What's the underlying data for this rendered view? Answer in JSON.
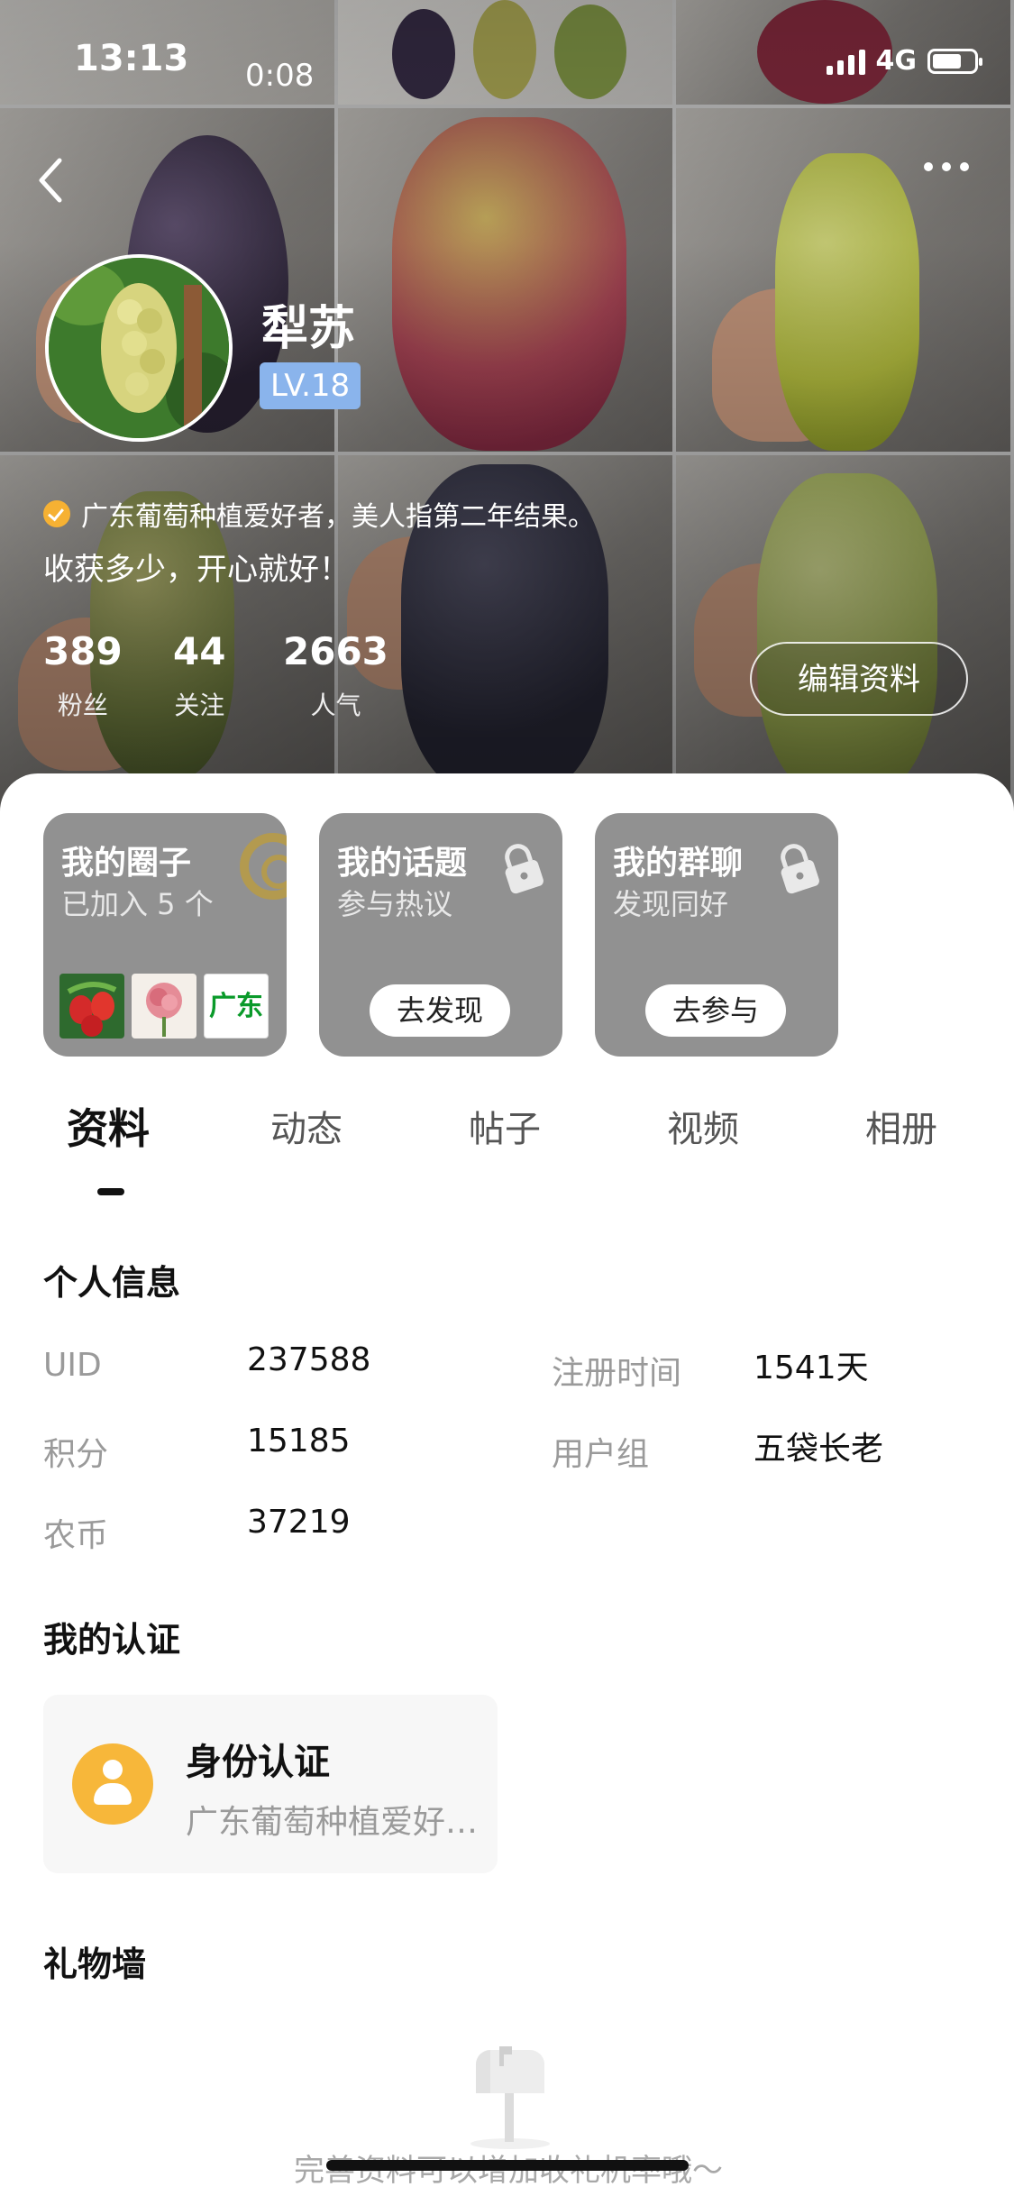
{
  "status_bar": {
    "time": "13:13",
    "recording_duration": "0:08",
    "network": "4G"
  },
  "header": {
    "back_icon": "chevron-left-icon",
    "more_icon": "more-dots-icon"
  },
  "profile": {
    "name": "犁苏",
    "level": "LV.18",
    "bio_line1": "广东葡萄种植爱好者，美人指第二年结果。",
    "bio_line2": "收获多少，开心就好！",
    "stats": [
      {
        "value": "389",
        "label": "粉丝"
      },
      {
        "value": "44",
        "label": "关注"
      },
      {
        "value": "2663",
        "label": "人气"
      }
    ],
    "edit_button": "编辑资料"
  },
  "cards": [
    {
      "title": "我的圈子",
      "subtitle": "已加入 5 个",
      "thumb_label": "广东"
    },
    {
      "title": "我的话题",
      "subtitle": "参与热议",
      "cta": "去发现"
    },
    {
      "title": "我的群聊",
      "subtitle": "发现同好",
      "cta": "去参与"
    }
  ],
  "tabs": [
    "资料",
    "动态",
    "帖子",
    "视频",
    "相册"
  ],
  "personal_info": {
    "title": "个人信息",
    "rows": [
      {
        "label": "UID",
        "value": "237588"
      },
      {
        "label": "注册时间",
        "value": "1541天"
      },
      {
        "label": "积分",
        "value": "15185"
      },
      {
        "label": "用户组",
        "value": "五袋长老"
      },
      {
        "label": "农币",
        "value": "37219"
      }
    ]
  },
  "certification": {
    "title": "我的认证",
    "card_title": "身份认证",
    "card_subtitle": "广东葡萄种植爱好者，美人指第二年结果。"
  },
  "gift_wall": {
    "title": "礼物墙",
    "empty_text": "完善资料可以增加收礼机率哦～"
  },
  "colors": {
    "level_badge": "#8ab4ec",
    "auth_icon": "#f7b73a",
    "card_bg": "#919191"
  }
}
